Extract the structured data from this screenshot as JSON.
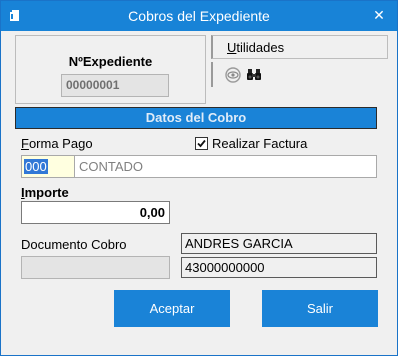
{
  "window": {
    "title": "Cobros del Expediente",
    "close_glyph": "✕"
  },
  "expediente": {
    "label": "NºExpediente",
    "value": "00000001"
  },
  "utilidades": {
    "label_prefix": "U",
    "label_rest": "tilidades"
  },
  "toolbar": {
    "icons": [
      "view-eye-icon",
      "binoculars-icon"
    ]
  },
  "section": {
    "title": "Datos del Cobro"
  },
  "forma_pago": {
    "label_prefix": "F",
    "label_rest": "orma Pago",
    "code": "000",
    "description": "CONTADO"
  },
  "realizar_factura": {
    "label": "Realizar Factura",
    "checked": true
  },
  "importe": {
    "label_prefix": "I",
    "label_rest": "mporte",
    "value": "0,00"
  },
  "documento_cobro": {
    "label": "Documento Cobro",
    "value": ""
  },
  "cliente": {
    "name": "ANDRES GARCIA",
    "account": "43000000000"
  },
  "buttons": {
    "accept": "Aceptar",
    "cancel": "Salir"
  },
  "colors": {
    "accent": "#1883d7",
    "header_bg": "#1a83d7",
    "input_highlight": "#ffffe0"
  }
}
